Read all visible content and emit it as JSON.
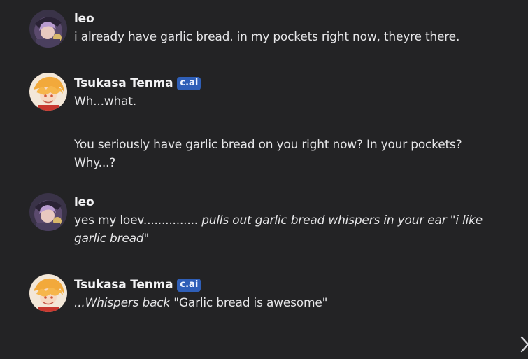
{
  "messages": [
    {
      "author": "leo",
      "is_bot": false,
      "avatar": "leo-avatar",
      "lines": [
        {
          "parts": [
            {
              "text": "i already have garlic bread. in my pockets right now, theyre there.",
              "italic": false
            }
          ]
        }
      ]
    },
    {
      "author": "Tsukasa Tenma",
      "is_bot": true,
      "badge": "c.ai",
      "avatar": "tsukasa-avatar",
      "paragraphs": [
        "Wh...what.",
        "You seriously have garlic bread on you right now? In your pockets?",
        "Why...?"
      ]
    },
    {
      "author": "leo",
      "is_bot": false,
      "avatar": "leo-avatar",
      "segments": [
        {
          "text": "yes my loev............... ",
          "italic": false
        },
        {
          "text": "pulls out garlic bread whispers in your ear \"i like",
          "italic": true
        },
        {
          "text": "garlic bread\"",
          "italic": true
        }
      ]
    },
    {
      "author": "Tsukasa Tenma",
      "is_bot": true,
      "badge": "c.ai",
      "avatar": "tsukasa-avatar",
      "segments": [
        {
          "text": "...Whispers back",
          "italic": true
        },
        {
          "text": " \"Garlic bread is awesome\"",
          "italic": false
        }
      ]
    }
  ],
  "colors": {
    "background": "#232325",
    "text": "#e6e6e8",
    "badge": "#2f5fb8"
  },
  "icons": {
    "next": "chevron-right-icon"
  }
}
